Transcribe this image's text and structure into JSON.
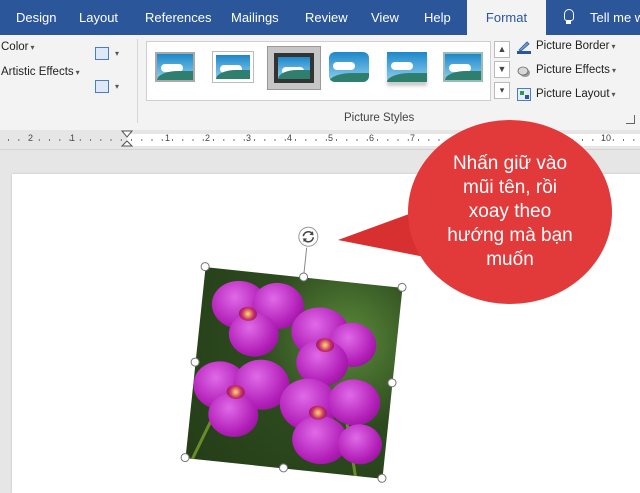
{
  "tabs": [
    {
      "label": "Design",
      "active": false
    },
    {
      "label": "Layout",
      "active": false
    },
    {
      "label": "References",
      "active": false
    },
    {
      "label": "Mailings",
      "active": false
    },
    {
      "label": "Review",
      "active": false
    },
    {
      "label": "View",
      "active": false
    },
    {
      "label": "Help",
      "active": false
    },
    {
      "label": "Format",
      "active": true
    }
  ],
  "tell_me": "Tell me w",
  "ribbon": {
    "adjust": {
      "color_label": "Color",
      "artistic_effects_label": "Artistic Effects"
    },
    "picture_styles": {
      "group_label": "Picture Styles",
      "picture_border_label": "Picture Border",
      "picture_effects_label": "Picture Effects",
      "picture_layout_label": "Picture Layout"
    }
  },
  "ruler": {
    "numbers": [
      "2",
      "1",
      "1",
      "2",
      "3",
      "4",
      "5",
      "6",
      "7",
      "8",
      "9",
      "10"
    ]
  },
  "callout": {
    "text_lines": [
      "Nhấn giữ vào",
      "mũi tên, rồi",
      "xoay theo",
      "hướng mà bạn",
      "muốn"
    ]
  },
  "colors": {
    "title_bar": "#2b579a",
    "callout_red": "#e23a3a",
    "orchid": "#b21fb8"
  }
}
